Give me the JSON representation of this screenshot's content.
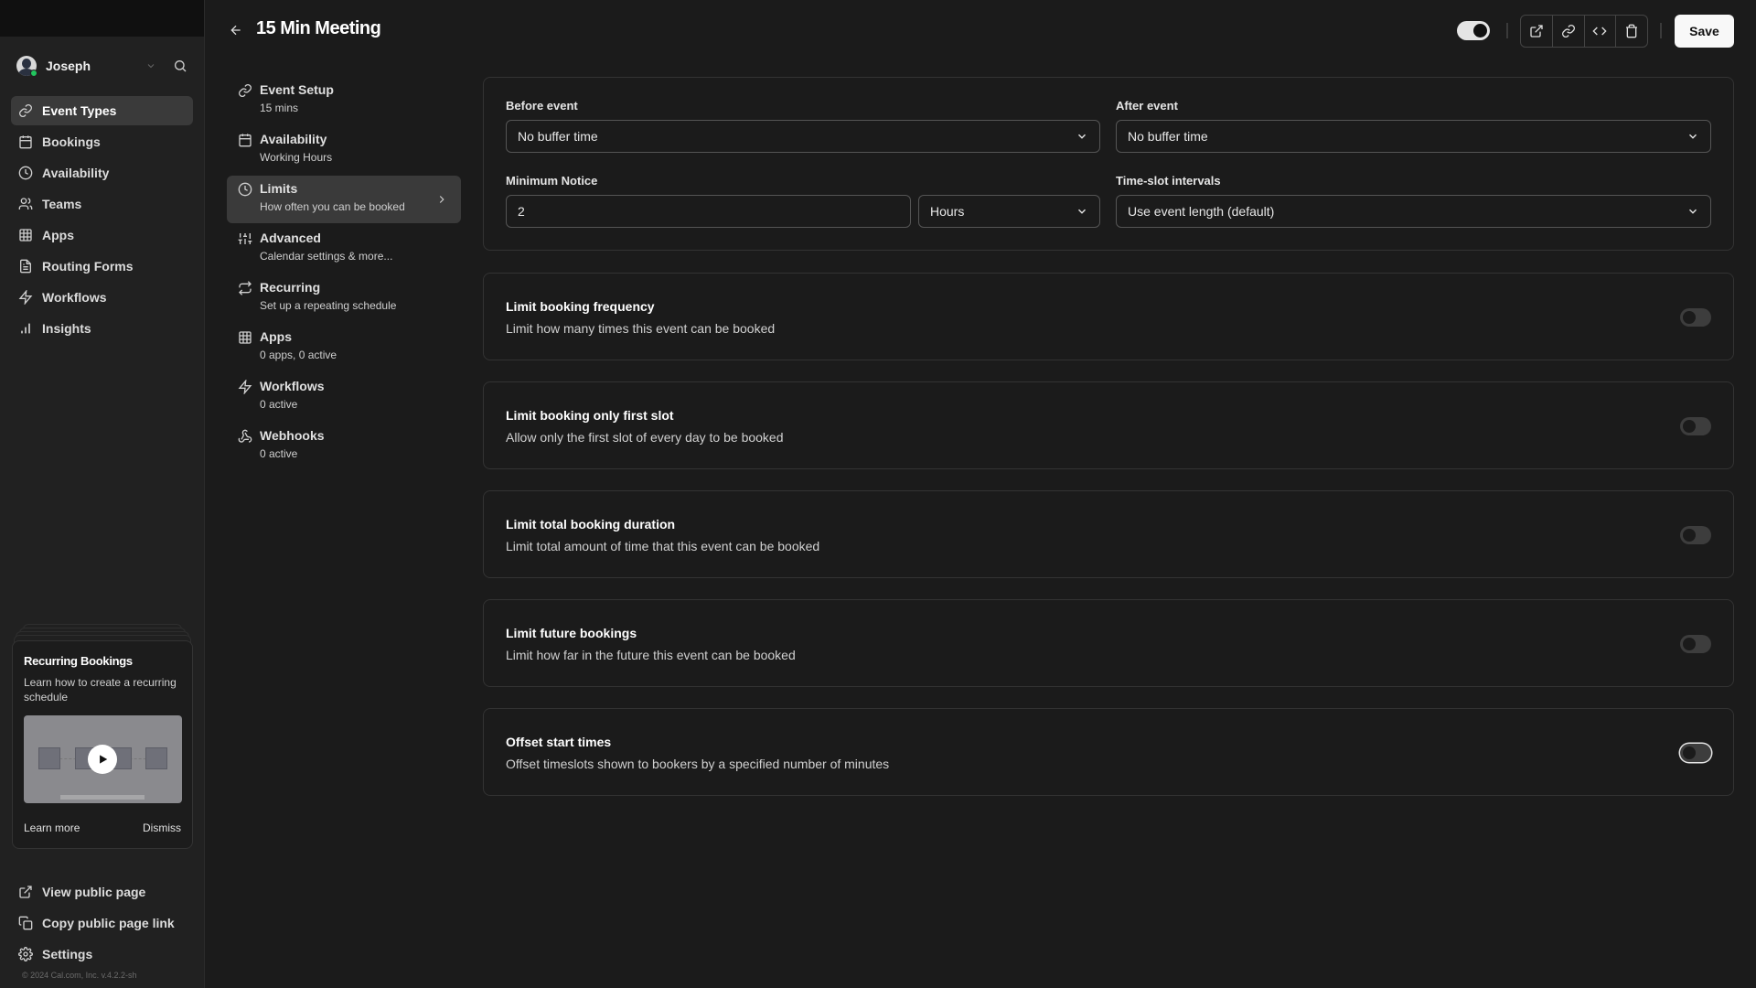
{
  "user": {
    "name": "Joseph",
    "status": "online"
  },
  "sidebar": {
    "items": [
      {
        "label": "Event Types",
        "icon": "link-icon",
        "active": true
      },
      {
        "label": "Bookings",
        "icon": "calendar-icon"
      },
      {
        "label": "Availability",
        "icon": "clock-icon"
      },
      {
        "label": "Teams",
        "icon": "users-icon"
      },
      {
        "label": "Apps",
        "icon": "grid-icon"
      },
      {
        "label": "Routing Forms",
        "icon": "file-text-icon"
      },
      {
        "label": "Workflows",
        "icon": "zap-icon"
      },
      {
        "label": "Insights",
        "icon": "bar-chart-icon"
      }
    ],
    "promo": {
      "title": "Recurring Bookings",
      "description": "Learn how to create a recurring schedule",
      "learn_more": "Learn more",
      "dismiss": "Dismiss"
    },
    "bottom_links": [
      {
        "label": "View public page",
        "icon": "external-link-icon"
      },
      {
        "label": "Copy public page link",
        "icon": "copy-icon"
      },
      {
        "label": "Settings",
        "icon": "gear-icon"
      }
    ],
    "copyright": "© 2024 Cal.com, Inc. v.4.2.2-sh"
  },
  "header": {
    "title": "15 Min Meeting",
    "hidden_toggle_on": true,
    "save_label": "Save"
  },
  "subnav": {
    "items": [
      {
        "title": "Event Setup",
        "subtitle": "15 mins",
        "icon": "link-icon"
      },
      {
        "title": "Availability",
        "subtitle": "Working Hours",
        "icon": "calendar-icon"
      },
      {
        "title": "Limits",
        "subtitle": "How often you can be booked",
        "icon": "clock-icon",
        "active": true
      },
      {
        "title": "Advanced",
        "subtitle": "Calendar settings & more...",
        "icon": "sliders-icon"
      },
      {
        "title": "Recurring",
        "subtitle": "Set up a repeating schedule",
        "icon": "repeat-icon"
      },
      {
        "title": "Apps",
        "subtitle": "0 apps, 0 active",
        "icon": "grid-icon"
      },
      {
        "title": "Workflows",
        "subtitle": "0 active",
        "icon": "zap-icon"
      },
      {
        "title": "Webhooks",
        "subtitle": "0 active",
        "icon": "webhook-icon"
      }
    ]
  },
  "limits": {
    "before_event": {
      "label": "Before event",
      "value": "No buffer time"
    },
    "after_event": {
      "label": "After event",
      "value": "No buffer time"
    },
    "minimum_notice": {
      "label": "Minimum Notice",
      "value": "2",
      "unit": "Hours"
    },
    "time_slot_intervals": {
      "label": "Time-slot intervals",
      "value": "Use event length (default)"
    },
    "toggles": [
      {
        "title": "Limit booking frequency",
        "description": "Limit how many times this event can be booked",
        "enabled": false
      },
      {
        "title": "Limit booking only first slot",
        "description": "Allow only the first slot of every day to be booked",
        "enabled": false
      },
      {
        "title": "Limit total booking duration",
        "description": "Limit total amount of time that this event can be booked",
        "enabled": false
      },
      {
        "title": "Limit future bookings",
        "description": "Limit how far in the future this event can be booked",
        "enabled": false
      },
      {
        "title": "Offset start times",
        "description": "Offset timeslots shown to bookers by a specified number of minutes",
        "enabled": false,
        "focused": true
      }
    ]
  }
}
